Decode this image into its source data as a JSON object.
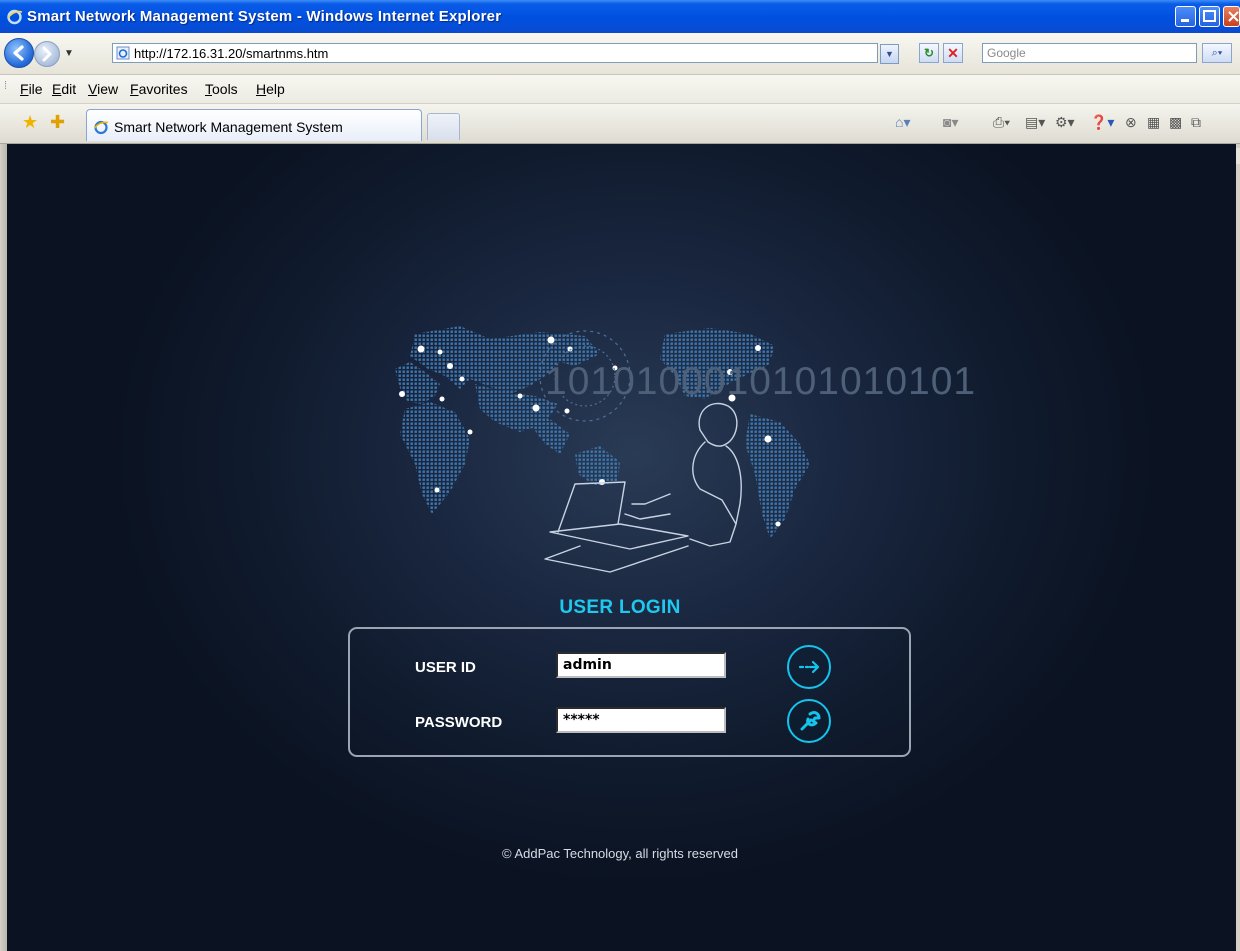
{
  "window": {
    "title": "Smart Network Management System - Windows Internet Explorer"
  },
  "address_bar": {
    "url": "http://172.16.31.20/smartnms.htm",
    "search_placeholder": "Google"
  },
  "menu": {
    "items": [
      "File",
      "Edit",
      "View",
      "Favorites",
      "Tools",
      "Help"
    ]
  },
  "tabs": {
    "active_label": "Smart Network Management System"
  },
  "page": {
    "binary_text": "1010100010101010101",
    "login_heading": "USER LOGIN",
    "user_id_label": "USER ID",
    "user_id_value": "admin",
    "password_label": "PASSWORD",
    "password_value": "*****",
    "copyright": "© AddPac Technology, all rights reserved"
  },
  "colors": {
    "accent": "#1ec8ee",
    "background": "#0f1a2c",
    "titlebar": "#0050e0"
  },
  "icons": {
    "login_button": "arrow-right-icon",
    "settings_button": "wrench-icon"
  }
}
